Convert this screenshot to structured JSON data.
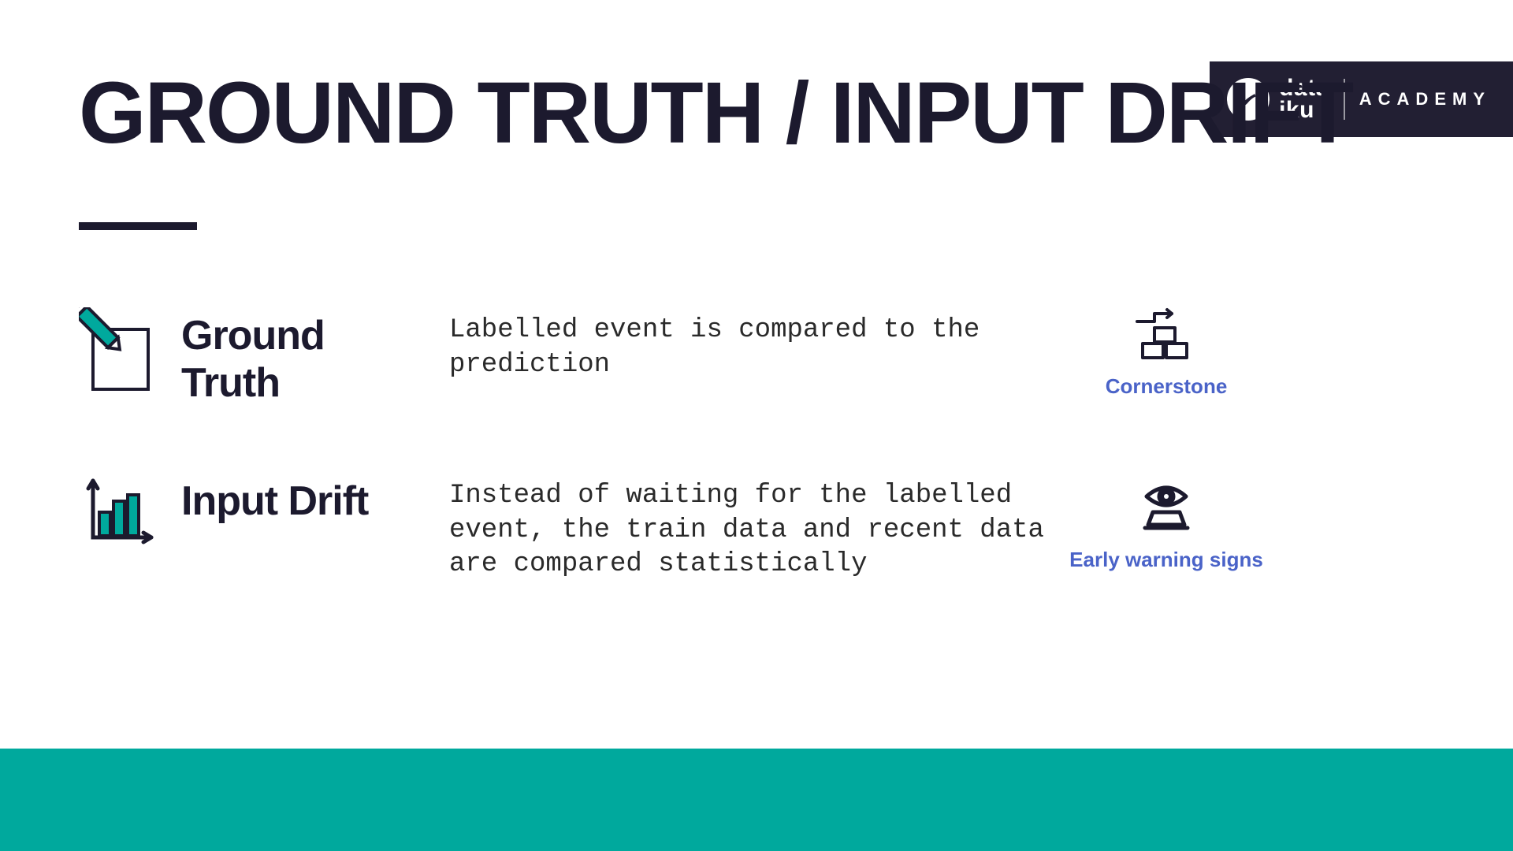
{
  "brand": {
    "line1": "data",
    "line2": "iku",
    "academy": "ACADEMY"
  },
  "title": "GROUND TRUTH / INPUT DRIFT",
  "rows": [
    {
      "label": "Ground Truth",
      "desc": "Labelled event is compared to the prediction",
      "caption": "Cornerstone"
    },
    {
      "label": "Input Drift",
      "desc": "Instead of waiting for the labelled event, the train data and recent data are compared statistically",
      "caption": "Early warning signs"
    }
  ],
  "colors": {
    "dark": "#1c1a2e",
    "teal": "#00a99d",
    "blue": "#4a63c8"
  }
}
